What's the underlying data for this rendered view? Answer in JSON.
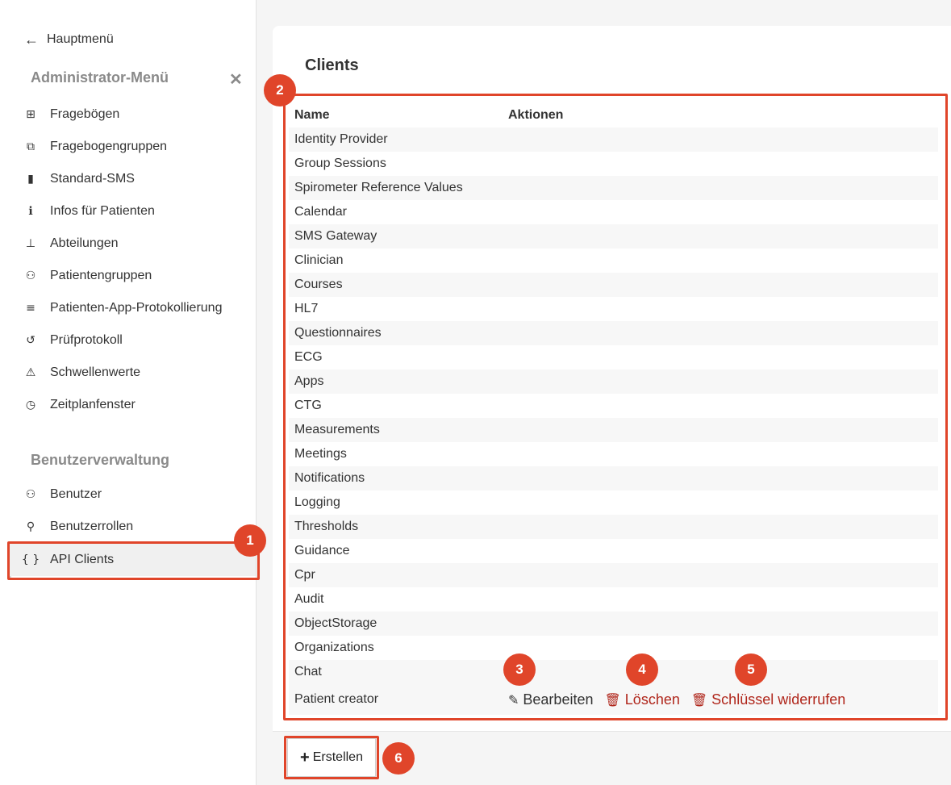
{
  "sidebar": {
    "back_label": "Hauptmenü",
    "admin_title": "Administrator-Menü",
    "close_glyph": "✕",
    "admin_items": [
      {
        "label": "Fragebögen",
        "icon": "file-plus-icon",
        "glyph": "⊞"
      },
      {
        "label": "Fragebogengruppen",
        "icon": "files-plus-icon",
        "glyph": "⧉"
      },
      {
        "label": "Standard-SMS",
        "icon": "mobile-phone-icon",
        "glyph": "▮"
      },
      {
        "label": "Infos für Patienten",
        "icon": "info-icon",
        "glyph": "ℹ"
      },
      {
        "label": "Abteilungen",
        "icon": "sitemap-icon",
        "glyph": "⊥"
      },
      {
        "label": "Patientengruppen",
        "icon": "patient-group-icon",
        "glyph": "⚇"
      },
      {
        "label": "Patienten-App-Protokollierung",
        "icon": "list-lines-icon",
        "glyph": "≡"
      },
      {
        "label": "Prüfprotokoll",
        "icon": "history-icon",
        "glyph": "↺"
      },
      {
        "label": "Schwellenwerte",
        "icon": "threshold-warning-icon",
        "glyph": "⚠"
      },
      {
        "label": "Zeitplanfenster",
        "icon": "clock-icon",
        "glyph": "◷"
      }
    ],
    "user_title": "Benutzerverwaltung",
    "user_items": [
      {
        "label": "Benutzer",
        "icon": "users-icon",
        "glyph": "⚇"
      },
      {
        "label": "Benutzerrollen",
        "icon": "user-role-icon",
        "glyph": "⚲"
      },
      {
        "label": "API Clients",
        "icon": "curly-braces-icon",
        "glyph": "{ }"
      }
    ]
  },
  "main": {
    "title": "Clients",
    "columns": {
      "name": "Name",
      "actions": "Aktionen"
    },
    "rows": [
      "Identity Provider",
      "Group Sessions",
      "Spirometer Reference Values",
      "Calendar",
      "SMS Gateway",
      "Clinician",
      "Courses",
      "HL7",
      "Questionnaires",
      "ECG",
      "Apps",
      "CTG",
      "Measurements",
      "Meetings",
      "Notifications",
      "Logging",
      "Thresholds",
      "Guidance",
      "Cpr",
      "Audit",
      "ObjectStorage",
      "Organizations",
      "Chat"
    ],
    "last_row": {
      "name": "Patient creator",
      "edit_label": "Bearbeiten",
      "delete_label": "Löschen",
      "revoke_label": "Schlüssel widerrufen"
    },
    "create_label": "Erstellen"
  },
  "annotations": [
    "1",
    "2",
    "3",
    "4",
    "5",
    "6"
  ],
  "colors": {
    "accent": "#e0452a",
    "danger": "#b0261b"
  }
}
